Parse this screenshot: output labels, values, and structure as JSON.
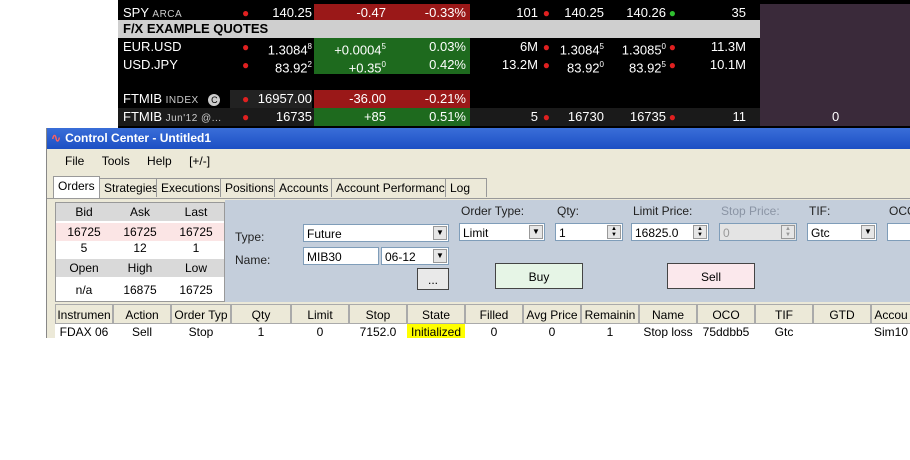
{
  "quotes": {
    "spy": {
      "symbol": "SPY",
      "exchange": "ARCA",
      "last": "140.25",
      "change": "-0.47",
      "pct": "-0.33%",
      "bid_size": "101",
      "bid": "140.25",
      "ask": "140.26",
      "ask_size": "35"
    },
    "fx_header": "F/X EXAMPLE QUOTES",
    "eurusd": {
      "symbol": "EUR.USD",
      "last": "1.3084",
      "last_frac": "8",
      "change": "+0.0004",
      "change_frac": "5",
      "pct": "0.03%",
      "bid_size": "6M",
      "bid": "1.3084",
      "bid_frac": "5",
      "ask": "1.3085",
      "ask_frac": "0",
      "ask_size": "11.3M"
    },
    "usdjpy": {
      "symbol": "USD.JPY",
      "last": "83.92",
      "last_frac": "2",
      "change": "+0.35",
      "change_frac": "0",
      "pct": "0.42%",
      "bid_size": "13.2M",
      "bid": "83.92",
      "bid_frac": "0",
      "ask": "83.92",
      "ask_frac": "5",
      "ask_size": "10.1M"
    },
    "ftmib_index": {
      "symbol": "FTMIB",
      "sub": "INDEX",
      "icon": "C",
      "last": "16957.00",
      "change": "-36.00",
      "pct": "-0.21%"
    },
    "ftmib_fut": {
      "symbol": "FTMIB",
      "sub": "Jun'12 @...",
      "last": "16735",
      "change": "+85",
      "pct": "0.51%",
      "bid_size": "5",
      "bid": "16730",
      "ask": "16735",
      "ask_size": "11",
      "position": "0"
    }
  },
  "window": {
    "title": "Control Center - Untitled1",
    "menu": [
      "File",
      "Tools",
      "Help",
      "[+/-]"
    ],
    "tabs": [
      "Orders",
      "Strategies",
      "Executions",
      "Positions",
      "Accounts",
      "Account Performance",
      "Log"
    ]
  },
  "quote_panel": {
    "headers1": [
      "Bid",
      "Ask",
      "Last"
    ],
    "values1": [
      "16725",
      "16725",
      "16725"
    ],
    "sizes": [
      "5",
      "12",
      "1"
    ],
    "headers2": [
      "Open",
      "High",
      "Low"
    ],
    "values2": [
      "n/a",
      "16875",
      "16725"
    ]
  },
  "order_panel": {
    "type_label": "Type:",
    "type_value": "Future",
    "name_label": "Name:",
    "name_value": "MIB30",
    "expiry_value": "06-12",
    "browse_label": "...",
    "order_type_label": "Order Type:",
    "order_type_value": "Limit",
    "qty_label": "Qty:",
    "qty_value": "1",
    "limit_label": "Limit Price:",
    "limit_value": "16825.0",
    "stop_label": "Stop Price:",
    "stop_value": "0",
    "tif_label": "TIF:",
    "tif_value": "Gtc",
    "oco_label": "OCO",
    "buy_label": "Buy",
    "sell_label": "Sell"
  },
  "orders_grid": {
    "columns": [
      "Instrumen",
      "Action",
      "Order Typ",
      "Qty",
      "Limit",
      "Stop",
      "State",
      "Filled",
      "Avg Price",
      "Remainin",
      "Name",
      "OCO",
      "TIF",
      "GTD",
      "Accou"
    ],
    "row": [
      "FDAX 06",
      "Sell",
      "Stop",
      "1",
      "0",
      "7152.0",
      "Initialized",
      "0",
      "0",
      "1",
      "Stop loss",
      "75ddbb5",
      "Gtc",
      "",
      "Sim10"
    ]
  },
  "colors": {
    "up": "#1e6a1e",
    "down": "#9a1818",
    "title_bar": "#1c4fc4",
    "buy": "#e6f5e6",
    "sell": "#fbe8ec",
    "state_initialized": "#ffff00"
  }
}
